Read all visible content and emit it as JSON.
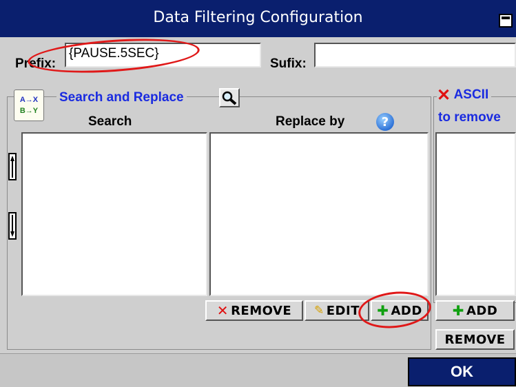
{
  "window": {
    "title": "Data Filtering Configuration"
  },
  "prefix": {
    "label": "Prefix:",
    "value": "{PAUSE.5SEC}"
  },
  "sufix": {
    "label": "Sufix:",
    "value": ""
  },
  "search_replace": {
    "legend": "Search and Replace",
    "icon_text_line1": "A→X",
    "icon_text_line2": "B→Y",
    "search_header": "Search",
    "replace_header": "Replace by",
    "remove_label": "REMOVE",
    "edit_label": "EDIT",
    "add_label": "ADD"
  },
  "ascii": {
    "legend": "ASCII",
    "sublabel": "to remove",
    "add_label": "ADD",
    "remove_label": "REMOVE"
  },
  "ok_label": "OK",
  "colors": {
    "title_bar": "#0a1f6e",
    "accent_blue_text": "#1a2be0",
    "highlight_red": "#e01818"
  }
}
